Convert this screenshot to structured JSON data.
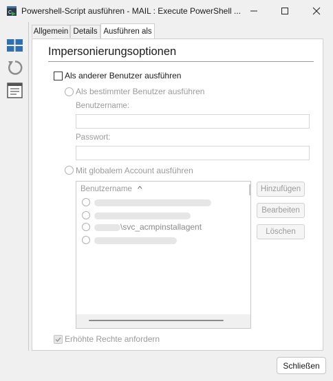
{
  "window": {
    "title": "Powershell-Script ausführen - MAIL : Execute PowerShell ..."
  },
  "tabs": [
    {
      "label": "Allgemein"
    },
    {
      "label": "Details"
    },
    {
      "label": "Ausführen als"
    }
  ],
  "section": {
    "title": "Impersonierungsoptionen"
  },
  "options": {
    "run_as_other": "Als anderer Benutzer ausführen",
    "run_as_specific": "Als bestimmter Benutzer ausführen",
    "username_label": "Benutzername:",
    "password_label": "Passwort:",
    "run_global": "Mit globalem Account ausführen",
    "elevated": "Erhöhte Rechte anfordern"
  },
  "accounts": {
    "column_header": "Benutzername",
    "sort_glyph": "^",
    "rows": [
      {
        "text": ""
      },
      {
        "text": ""
      },
      {
        "text": "\\svc_acmpinstallagent"
      },
      {
        "text": ""
      }
    ]
  },
  "side_buttons": {
    "add": "Hinzufügen",
    "edit": "Bearbeiten",
    "delete": "Löschen"
  },
  "footer": {
    "close": "Schließen"
  },
  "icons": {
    "app": "powershell-script-icon",
    "minimize": "minimize-icon",
    "maximize": "maximize-icon",
    "close": "close-icon",
    "sidebar_1": "grid-icon",
    "sidebar_2": "refresh-icon",
    "sidebar_3": "document-icon"
  },
  "colors": {
    "accent": "#2f6fb3",
    "disabled_text": "#9b9b9b"
  }
}
